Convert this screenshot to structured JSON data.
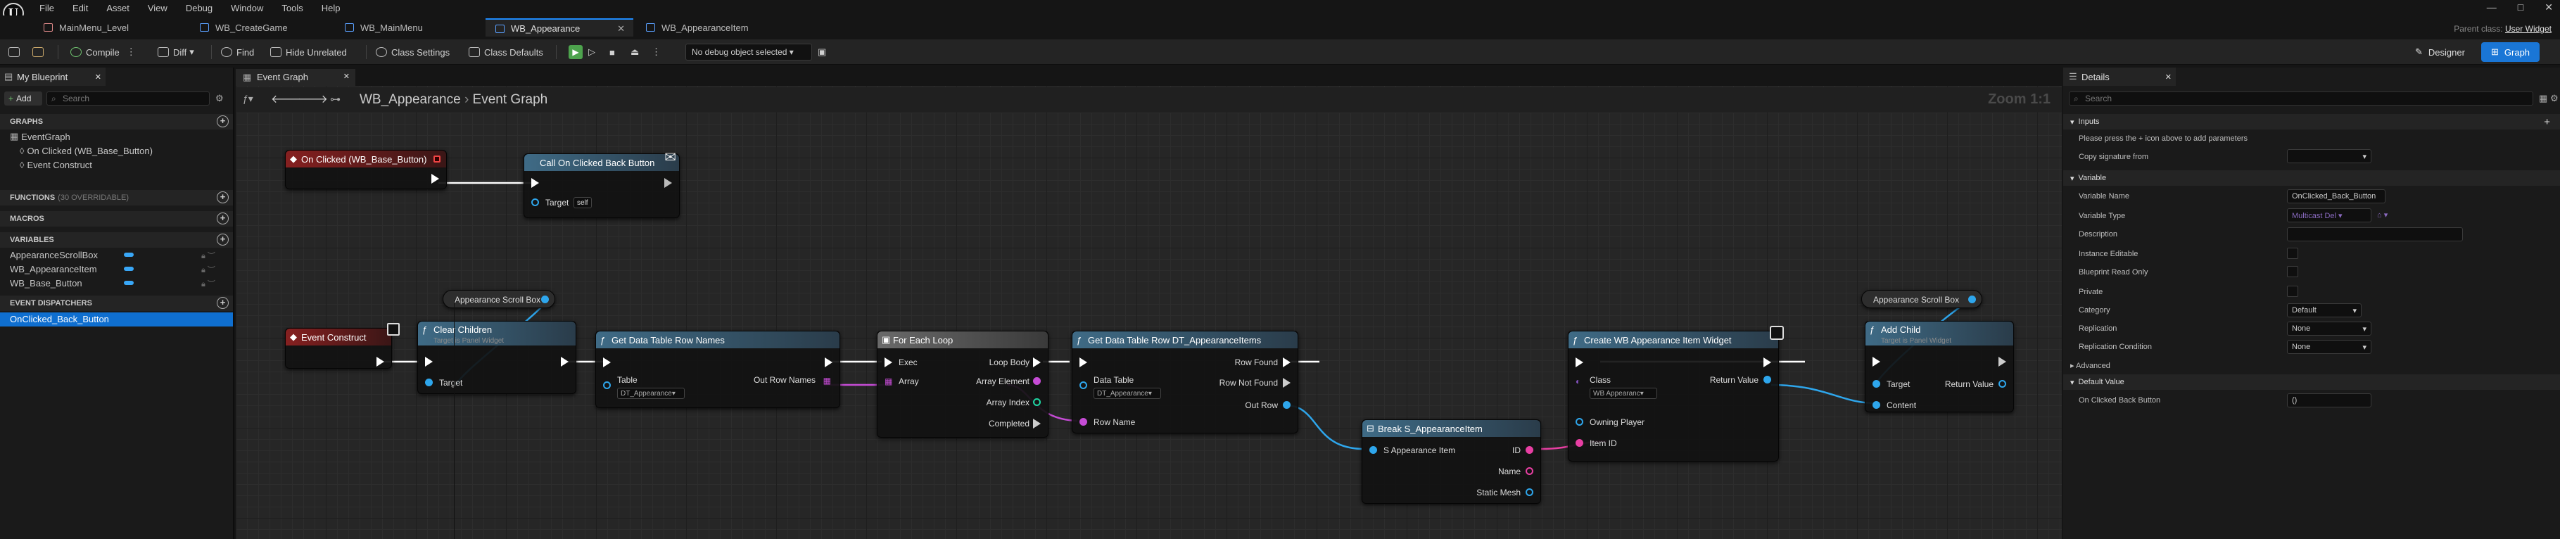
{
  "menu": {
    "items": [
      "File",
      "Edit",
      "Asset",
      "View",
      "Debug",
      "Window",
      "Tools",
      "Help"
    ]
  },
  "tabs": [
    {
      "label": "MainMenu_Level",
      "active": false
    },
    {
      "label": "WB_CreateGame",
      "active": false
    },
    {
      "label": "WB_MainMenu",
      "active": false
    },
    {
      "label": "WB_Appearance",
      "active": true
    },
    {
      "label": "WB_AppearanceItem",
      "active": false
    }
  ],
  "parent_class": {
    "label": "Parent class:",
    "value": "User Widget"
  },
  "toolbar": {
    "compile": "Compile",
    "diff": "Diff",
    "find": "Find",
    "hide_unrelated": "Hide Unrelated",
    "class_settings": "Class Settings",
    "class_defaults": "Class Defaults",
    "debug_object": "No debug object selected",
    "designer": "Designer",
    "graph": "Graph"
  },
  "my_blueprint": {
    "title": "My Blueprint",
    "add": "Add",
    "search_placeholder": "Search",
    "graphs_header": "GRAPHS",
    "graphs": [
      "EventGraph",
      "On Clicked (WB_Base_Button)",
      "Event Construct"
    ],
    "functions_header": "FUNCTIONS",
    "functions_hint": "(30 OVERRIDABLE)",
    "macros_header": "MACROS",
    "variables_header": "VARIABLES",
    "variables": [
      "AppearanceScrollBox",
      "WB_AppearanceItem",
      "WB_Base_Button"
    ],
    "dispatchers_header": "EVENT DISPATCHERS",
    "dispatchers": [
      "OnClicked_Back_Button"
    ]
  },
  "graph": {
    "tab_title": "Event Graph",
    "breadcrumb_root": "WB_Appearance",
    "breadcrumb_graph": "Event Graph",
    "zoom": "Zoom 1:1",
    "nodes": {
      "on_clicked": {
        "title": "On Clicked (WB_Base_Button)"
      },
      "call_back": {
        "title": "Call On Clicked Back Button",
        "target": "Target",
        "target_value": "self"
      },
      "event_construct": {
        "title": "Event Construct"
      },
      "scrollbox1": {
        "title": "Appearance Scroll Box"
      },
      "clear_children": {
        "title": "Clear Children",
        "sub": "Target is Panel Widget",
        "target": "Target"
      },
      "get_row_names": {
        "title": "Get Data Table Row Names",
        "table": "Table",
        "table_value": "DT_Appearance",
        "out": "Out Row Names"
      },
      "for_each": {
        "title": "For Each Loop",
        "exec": "Exec",
        "loop_body": "Loop Body",
        "array": "Array",
        "array_element": "Array Element",
        "array_index": "Array Index",
        "completed": "Completed"
      },
      "get_row": {
        "title": "Get Data Table Row DT_AppearanceItems",
        "data_table": "Data Table",
        "dt_value": "DT_Appearance",
        "row_name": "Row Name",
        "row_found": "Row Found",
        "row_not_found": "Row Not Found",
        "out_row": "Out Row"
      },
      "break_item": {
        "title": "Break S_AppearanceItem",
        "in": "S Appearance Item",
        "id": "ID",
        "name": "Name",
        "mesh": "Static Mesh"
      },
      "create_widget": {
        "title": "Create WB Appearance Item Widget",
        "class": "Class",
        "class_value": "WB Appearanc",
        "owning": "Owning Player",
        "item_id": "Item ID",
        "return": "Return Value"
      },
      "scrollbox2": {
        "title": "Appearance Scroll Box"
      },
      "add_child": {
        "title": "Add Child",
        "sub": "Target is Panel Widget",
        "target": "Target",
        "content": "Content",
        "return": "Return Value"
      }
    }
  },
  "details": {
    "title": "Details",
    "search_placeholder": "Search",
    "inputs_header": "Inputs",
    "inputs_hint": "Please press the + icon above to add parameters",
    "copy_sig": "Copy signature from",
    "variable_header": "Variable",
    "variable_name_label": "Variable Name",
    "variable_name": "OnClicked_Back_Button",
    "variable_type_label": "Variable Type",
    "variable_type": "Multicast Del",
    "description_label": "Description",
    "instance_editable": "Instance Editable",
    "bp_readonly": "Blueprint Read Only",
    "private": "Private",
    "category_label": "Category",
    "category": "Default",
    "replication_label": "Replication",
    "replication": "None",
    "rep_condition_label": "Replication Condition",
    "rep_condition": "None",
    "advanced": "Advanced",
    "default_value_header": "Default Value",
    "default_value_label": "On Clicked Back Button",
    "default_value": "()"
  }
}
